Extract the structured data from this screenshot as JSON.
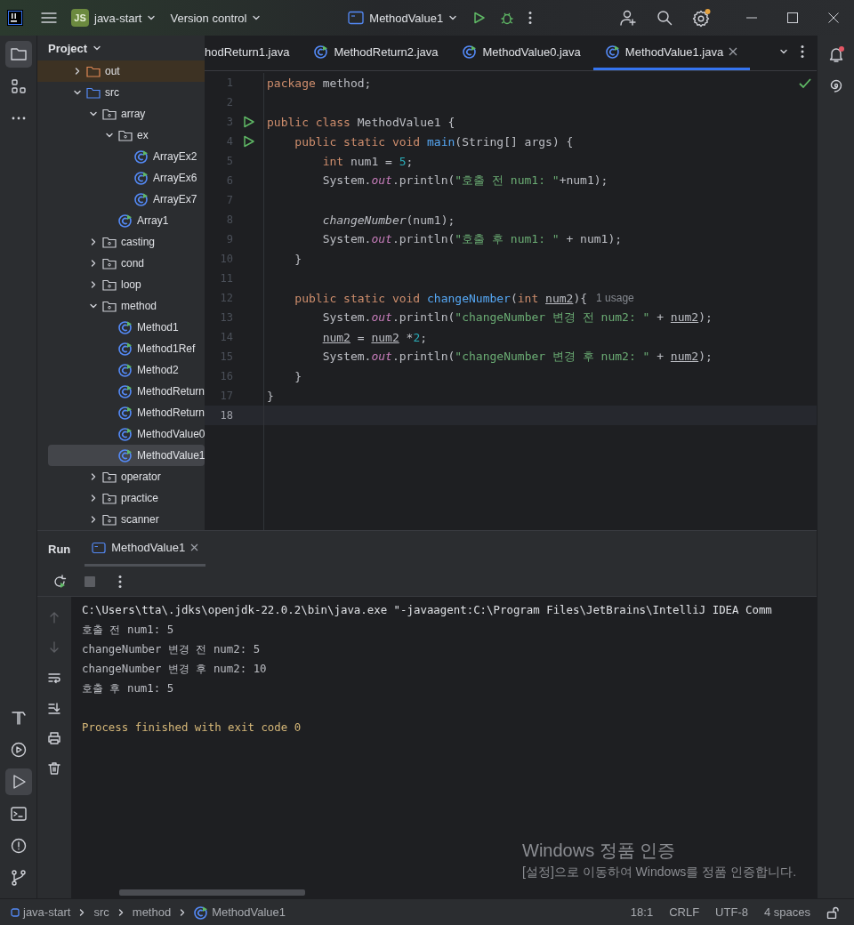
{
  "title_bar": {
    "project_badge": "JS",
    "project": "java-start",
    "vcs": "Version control",
    "run_config": "MethodValue1"
  },
  "left_tools": [
    {
      "kind": "project",
      "selected": true
    },
    {
      "kind": "structure",
      "selected": false
    },
    {
      "kind": "more",
      "selected": false
    }
  ],
  "left_tools_bottom": [
    {
      "kind": "build",
      "selected": false
    },
    {
      "kind": "services",
      "selected": false
    },
    {
      "kind": "run",
      "selected": true
    },
    {
      "kind": "terminal",
      "selected": false
    },
    {
      "kind": "problems",
      "selected": false
    },
    {
      "kind": "git",
      "selected": false
    }
  ],
  "project_panel": {
    "title": "Project",
    "tree": [
      {
        "label": "out",
        "kind": "excluded",
        "expanded": false,
        "selected": false
      },
      {
        "label": "src",
        "kind": "source",
        "expanded": true,
        "selected": false,
        "children": [
          {
            "label": "array",
            "kind": "package",
            "expanded": true,
            "selected": false,
            "children": [
              {
                "label": "ex",
                "kind": "package",
                "expanded": true,
                "selected": false,
                "children": [
                  {
                    "label": "ArrayEx2",
                    "kind": "class",
                    "selected": false
                  },
                  {
                    "label": "ArrayEx6",
                    "kind": "class",
                    "selected": false
                  },
                  {
                    "label": "ArrayEx7",
                    "kind": "class",
                    "selected": false
                  }
                ]
              },
              {
                "label": "Array1",
                "kind": "class",
                "selected": false
              }
            ]
          },
          {
            "label": "casting",
            "kind": "package",
            "expanded": false,
            "selected": false
          },
          {
            "label": "cond",
            "kind": "package",
            "expanded": false,
            "selected": false
          },
          {
            "label": "loop",
            "kind": "package",
            "expanded": false,
            "selected": false
          },
          {
            "label": "method",
            "kind": "package",
            "expanded": true,
            "selected": false,
            "children": [
              {
                "label": "Method1",
                "kind": "class",
                "selected": false
              },
              {
                "label": "Method1Ref",
                "kind": "class",
                "selected": false
              },
              {
                "label": "Method2",
                "kind": "class",
                "selected": false
              },
              {
                "label": "MethodReturn",
                "kind": "class",
                "selected": false
              },
              {
                "label": "MethodReturn",
                "kind": "class",
                "selected": false
              },
              {
                "label": "MethodValue0",
                "kind": "class",
                "selected": false
              },
              {
                "label": "MethodValue1",
                "kind": "class",
                "selected": true
              }
            ]
          },
          {
            "label": "operator",
            "kind": "package",
            "expanded": false,
            "selected": false
          },
          {
            "label": "practice",
            "kind": "package",
            "expanded": false,
            "selected": false
          },
          {
            "label": "scanner",
            "kind": "package",
            "expanded": false,
            "selected": false
          }
        ]
      }
    ]
  },
  "editor": {
    "inspection_ok": true,
    "tabs": [
      {
        "label": "hodReturn1.java",
        "selected": false,
        "icon": false
      },
      {
        "label": "MethodReturn2.java",
        "selected": false,
        "icon": true
      },
      {
        "label": "MethodValue0.java",
        "selected": false,
        "icon": true
      },
      {
        "label": "MethodValue1.java",
        "selected": true,
        "icon": true
      }
    ],
    "lines": [
      {
        "number": "1",
        "run_gutter": false,
        "current": false,
        "tokens": [
          {
            "text": "package",
            "kind": "keyword"
          },
          {
            "text": " method;",
            "kind": "plain"
          }
        ]
      },
      {
        "number": "2",
        "run_gutter": false,
        "current": false
      },
      {
        "number": "3",
        "run_gutter": true,
        "current": false,
        "tokens": [
          {
            "text": "public class",
            "kind": "keyword"
          },
          {
            "text": " MethodValue1 {",
            "kind": "plain"
          }
        ]
      },
      {
        "number": "4",
        "run_gutter": true,
        "current": false,
        "tokens": [
          {
            "text": "    public static void ",
            "kind": "keyword"
          },
          {
            "text": "main",
            "kind": "method"
          },
          {
            "text": "(String[] args) {",
            "kind": "plain"
          }
        ]
      },
      {
        "number": "5",
        "run_gutter": false,
        "current": false,
        "tokens": [
          {
            "text": "        int",
            "kind": "keyword"
          },
          {
            "text": " num1 = ",
            "kind": "plain"
          },
          {
            "text": "5",
            "kind": "number"
          },
          {
            "text": ";",
            "kind": "plain"
          }
        ]
      },
      {
        "number": "6",
        "run_gutter": false,
        "current": false,
        "tokens": [
          {
            "text": "        System.",
            "kind": "plain"
          },
          {
            "text": "out",
            "kind": "static"
          },
          {
            "text": ".println(",
            "kind": "plain"
          },
          {
            "text": "\"호출 전 num1: \"",
            "kind": "string"
          },
          {
            "text": "+num1);",
            "kind": "plain"
          }
        ]
      },
      {
        "number": "7",
        "run_gutter": false,
        "current": false
      },
      {
        "number": "8",
        "run_gutter": false,
        "current": false,
        "tokens": [
          {
            "text": "        changeNumber",
            "kind": "call"
          },
          {
            "text": "(num1);",
            "kind": "plain"
          }
        ]
      },
      {
        "number": "9",
        "run_gutter": false,
        "current": false,
        "tokens": [
          {
            "text": "        System.",
            "kind": "plain"
          },
          {
            "text": "out",
            "kind": "static"
          },
          {
            "text": ".println(",
            "kind": "plain"
          },
          {
            "text": "\"호출 후 num1: \"",
            "kind": "string"
          },
          {
            "text": " + num1);",
            "kind": "plain"
          }
        ]
      },
      {
        "number": "10",
        "run_gutter": false,
        "current": false,
        "tokens": [
          {
            "text": "    }",
            "kind": "plain"
          }
        ]
      },
      {
        "number": "11",
        "run_gutter": false,
        "current": false
      },
      {
        "number": "12",
        "run_gutter": false,
        "current": false,
        "tokens": [
          {
            "text": "    public static void ",
            "kind": "keyword"
          },
          {
            "text": "changeNumber",
            "kind": "method"
          },
          {
            "text": "(",
            "kind": "plain"
          },
          {
            "text": "int ",
            "kind": "keyword"
          },
          {
            "text": "num2",
            "kind": "param"
          },
          {
            "text": "){",
            "kind": "plain"
          },
          {
            "text": "1 usage",
            "kind": "hint"
          }
        ]
      },
      {
        "number": "13",
        "run_gutter": false,
        "current": false,
        "tokens": [
          {
            "text": "        System.",
            "kind": "plain"
          },
          {
            "text": "out",
            "kind": "static"
          },
          {
            "text": ".println(",
            "kind": "plain"
          },
          {
            "text": "\"changeNumber 변경 전 num2: \"",
            "kind": "string"
          },
          {
            "text": " + ",
            "kind": "plain"
          },
          {
            "text": "num2",
            "kind": "param"
          },
          {
            "text": ");",
            "kind": "plain"
          }
        ]
      },
      {
        "number": "14",
        "run_gutter": false,
        "current": false,
        "tokens": [
          {
            "text": "        num2",
            "kind": "param"
          },
          {
            "text": " = ",
            "kind": "plain"
          },
          {
            "text": "num2",
            "kind": "param"
          },
          {
            "text": " *",
            "kind": "plain"
          },
          {
            "text": "2",
            "kind": "number"
          },
          {
            "text": ";",
            "kind": "plain"
          }
        ]
      },
      {
        "number": "15",
        "run_gutter": false,
        "current": false,
        "tokens": [
          {
            "text": "        System.",
            "kind": "plain"
          },
          {
            "text": "out",
            "kind": "static"
          },
          {
            "text": ".println(",
            "kind": "plain"
          },
          {
            "text": "\"changeNumber 변경 후 num2: \"",
            "kind": "string"
          },
          {
            "text": " + ",
            "kind": "plain"
          },
          {
            "text": "num2",
            "kind": "param"
          },
          {
            "text": ");",
            "kind": "plain"
          }
        ]
      },
      {
        "number": "16",
        "run_gutter": false,
        "current": false,
        "tokens": [
          {
            "text": "    }",
            "kind": "plain"
          }
        ]
      },
      {
        "number": "17",
        "run_gutter": false,
        "current": false,
        "tokens": [
          {
            "text": "}",
            "kind": "plain"
          }
        ]
      },
      {
        "number": "18",
        "run_gutter": false,
        "current": true
      }
    ]
  },
  "run_panel": {
    "title": "Run",
    "tabs": [
      {
        "label": "MethodValue1",
        "selected": true
      }
    ],
    "console": [
      {
        "text": "C:\\Users\\tta\\.jdks\\openjdk-22.0.2\\bin\\java.exe \"-javaagent:C:\\Program Files\\JetBrains\\IntelliJ IDEA Comm",
        "kind": "command"
      },
      {
        "text": "호출 전 num1: 5",
        "kind": "output"
      },
      {
        "text": "changeNumber 변경 전 num2: 5",
        "kind": "output"
      },
      {
        "text": "changeNumber 변경 후 num2: 10",
        "kind": "output"
      },
      {
        "text": "호출 후 num1: 5",
        "kind": "output"
      },
      {
        "text": "Process finished with exit code 0",
        "kind": "exit"
      }
    ]
  },
  "activation_notice": {
    "title": "Windows 정품 인증",
    "message": "[설정]으로 이동하여 Windows를 정품 인증합니다."
  },
  "status_bar": {
    "breadcrumbs": [
      {
        "label": "java-start",
        "kind": "module"
      },
      {
        "label": "src",
        "kind": "folder"
      },
      {
        "label": "method",
        "kind": "folder"
      },
      {
        "label": "MethodValue1",
        "kind": "class"
      }
    ],
    "items": [
      "18:1",
      "CRLF",
      "UTF-8",
      "4 spaces"
    ]
  }
}
